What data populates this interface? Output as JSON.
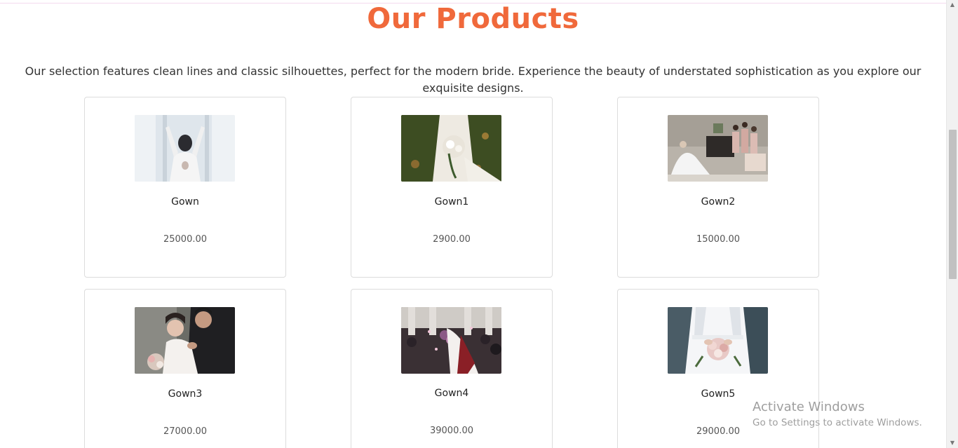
{
  "page": {
    "title": "Our Products",
    "intro": "Our selection features clean lines and classic silhouettes, perfect for the modern bride. Experience the beauty of understated sophistication as you explore our exquisite designs."
  },
  "products": [
    {
      "name": "Gown",
      "price": "25000.00",
      "image": "bride-by-window-photo"
    },
    {
      "name": "Gown1",
      "price": "2900.00",
      "image": "bride-with-bouquet-photo"
    },
    {
      "name": "Gown2",
      "price": "15000.00",
      "image": "bridal-party-photo"
    },
    {
      "name": "Gown3",
      "price": "27000.00",
      "image": "couple-embrace-photo"
    },
    {
      "name": "Gown4",
      "price": "39000.00",
      "image": "wedding-exit-photo"
    },
    {
      "name": "Gown5",
      "price": "29000.00",
      "image": "bride-holding-bouquet-photo"
    }
  ],
  "watermark": {
    "line1": "Activate Windows",
    "line2": "Go to Settings to activate Windows."
  },
  "colors": {
    "accent": "#f0693b",
    "border": "#dcdcdc"
  }
}
